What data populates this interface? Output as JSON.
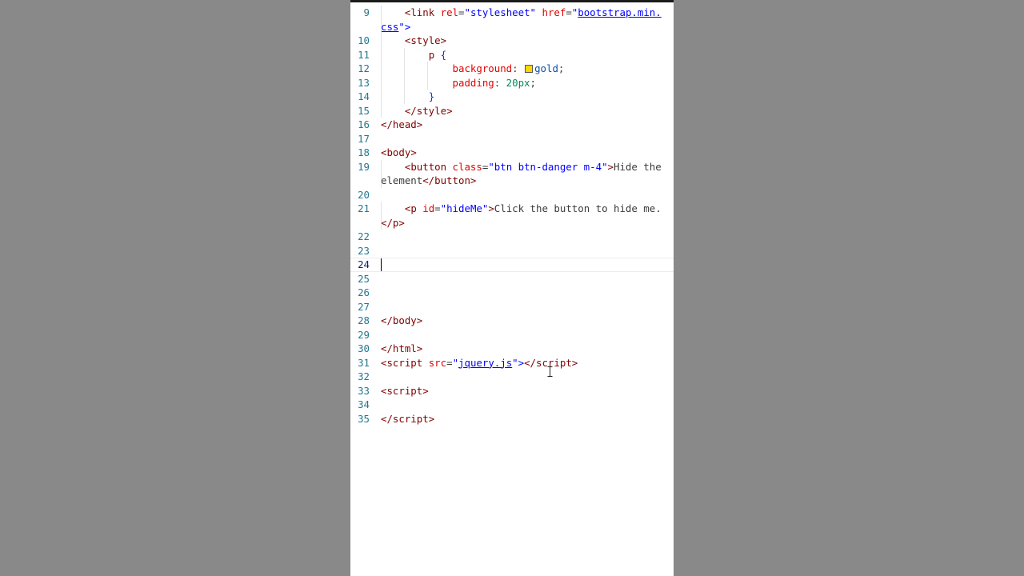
{
  "editor": {
    "language": "html",
    "active_line": "24",
    "swatch_color": "#ffd700"
  },
  "lines": [
    {
      "n": "9",
      "indent": 1,
      "t": [
        "<",
        "link",
        " ",
        "rel",
        "=",
        "\"stylesheet\"",
        " ",
        "href",
        "=",
        "\"",
        "bootstrap.min.css",
        "\">"
      ]
    },
    {
      "n": "10",
      "indent": 1,
      "t": [
        "<",
        "style",
        ">"
      ]
    },
    {
      "n": "11",
      "indent": 2,
      "t": [
        "p",
        " ",
        "{"
      ]
    },
    {
      "n": "12",
      "indent": 3,
      "t": [
        "background",
        ": ",
        "gold",
        ";"
      ]
    },
    {
      "n": "13",
      "indent": 3,
      "t": [
        "padding",
        ": ",
        "20px",
        ";"
      ]
    },
    {
      "n": "14",
      "indent": 2,
      "t": [
        "}"
      ]
    },
    {
      "n": "15",
      "indent": 1,
      "t": [
        "</",
        "style",
        ">"
      ]
    },
    {
      "n": "16",
      "indent": 0,
      "t": [
        "</",
        "head",
        ">"
      ]
    },
    {
      "n": "17",
      "indent": 0,
      "t": []
    },
    {
      "n": "18",
      "indent": 0,
      "t": [
        "<",
        "body",
        ">"
      ]
    },
    {
      "n": "19",
      "indent": 1,
      "t": [
        "<",
        "button",
        " ",
        "class",
        "=",
        "\"btn btn-danger m-4\"",
        ">",
        "Hide the element",
        "</",
        "button",
        ">"
      ]
    },
    {
      "n": "20",
      "indent": 0,
      "t": []
    },
    {
      "n": "21",
      "indent": 1,
      "t": [
        "<",
        "p",
        " ",
        "id",
        "=",
        "\"hideMe\"",
        ">",
        "Click the button to hide me.",
        "</",
        "p",
        ">"
      ]
    },
    {
      "n": "22",
      "indent": 0,
      "t": []
    },
    {
      "n": "23",
      "indent": 0,
      "t": []
    },
    {
      "n": "24",
      "indent": 0,
      "t": []
    },
    {
      "n": "25",
      "indent": 0,
      "t": []
    },
    {
      "n": "26",
      "indent": 0,
      "t": []
    },
    {
      "n": "27",
      "indent": 0,
      "t": []
    },
    {
      "n": "28",
      "indent": 0,
      "t": [
        "</",
        "body",
        ">"
      ]
    },
    {
      "n": "29",
      "indent": 0,
      "t": []
    },
    {
      "n": "30",
      "indent": 0,
      "t": [
        "</",
        "html",
        ">"
      ]
    },
    {
      "n": "31",
      "indent": 0,
      "t": [
        "<",
        "script",
        " ",
        "src",
        "=",
        "\"",
        "jquery.js",
        "\">",
        "</",
        "script",
        ">"
      ]
    },
    {
      "n": "32",
      "indent": 0,
      "t": []
    },
    {
      "n": "33",
      "indent": 0,
      "t": [
        "<",
        "script",
        ">"
      ]
    },
    {
      "n": "34",
      "indent": 0,
      "t": []
    },
    {
      "n": "35",
      "indent": 0,
      "t": [
        "</",
        "script",
        ">"
      ]
    }
  ]
}
